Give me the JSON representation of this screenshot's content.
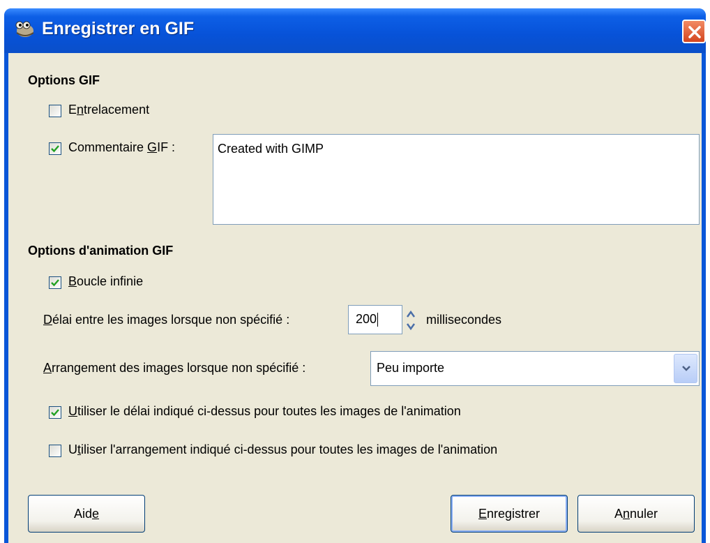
{
  "window": {
    "title": "Enregistrer en GIF"
  },
  "gif_options": {
    "heading": "Options GIF",
    "interlace": {
      "label_prefix": "E",
      "label_mnemonic": "n",
      "label_suffix": "trelacement",
      "checked": false
    },
    "comment": {
      "label_prefix": "Commentaire ",
      "label_mnemonic": "G",
      "label_suffix": "IF :",
      "checked": true,
      "value": "Created with GIMP"
    }
  },
  "animation_options": {
    "heading": "Options d'animation GIF",
    "loop": {
      "label_prefix": "",
      "label_mnemonic": "B",
      "label_suffix": "oucle infinie",
      "checked": true
    },
    "delay": {
      "label_prefix": "",
      "label_mnemonic": "D",
      "label_suffix": "élai entre les images lorsque non spécifié :",
      "value": "200",
      "unit": "millisecondes"
    },
    "disposal": {
      "label_prefix": "",
      "label_mnemonic": "A",
      "label_suffix": "rrangement des images lorsque non spécifié :",
      "selected": "Peu importe"
    },
    "use_delay": {
      "label_prefix": "",
      "label_mnemonic": "U",
      "label_suffix": "tiliser le délai indiqué ci-dessus pour toutes les images de l'animation",
      "checked": true
    },
    "use_disposal": {
      "label_prefix": "U",
      "label_mnemonic": "t",
      "label_suffix": "iliser l'arrangement indiqué ci-dessus pour toutes les images de l'animation",
      "checked": false
    }
  },
  "buttons": {
    "help": {
      "prefix": "Aid",
      "mnemonic": "e",
      "suffix": ""
    },
    "save": {
      "prefix": "",
      "mnemonic": "E",
      "suffix": "nregistrer"
    },
    "cancel": {
      "prefix": "A",
      "mnemonic": "n",
      "suffix": "nuler"
    }
  },
  "colors": {
    "title_bar": "#0752d8",
    "dialog_bg": "#ece9d8",
    "close_button": "#d4451f",
    "check_mark": "#21a121"
  },
  "icons": [
    "gimp-icon",
    "close-icon",
    "checkbox-check-icon",
    "spin-arrows-icon",
    "chevron-down-icon"
  ]
}
